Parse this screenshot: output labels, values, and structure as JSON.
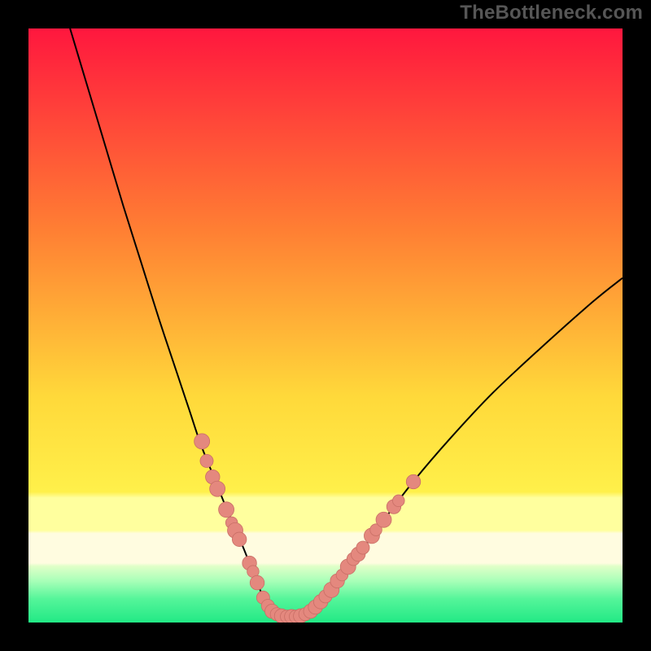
{
  "watermark": "TheBottleneck.com",
  "colors": {
    "frame": "#000000",
    "bg_top": "#ff173e",
    "bg_mid1": "#ff7f27",
    "bg_mid2": "#ffe635",
    "bg_band_light": "#ffff9e",
    "bg_band_cream": "#fffce0",
    "bg_bottom": "#27ec88",
    "curve": "#000000",
    "marker_fill": "#e4887e",
    "marker_stroke": "#c96f66"
  },
  "chart_data": {
    "type": "line",
    "title": "",
    "xlabel": "",
    "ylabel": "",
    "xlim": [
      0,
      100
    ],
    "ylim": [
      0,
      100
    ],
    "series": [
      {
        "name": "bottleneck-curve",
        "x": [
          7,
          10,
          13,
          16,
          19,
          22,
          25,
          27,
          29,
          31,
          33,
          34.5,
          36,
          37,
          38,
          38.8,
          39.4,
          40,
          40.5,
          41,
          42,
          43,
          44,
          45,
          46,
          47.5,
          49,
          51,
          53,
          56,
          60,
          65,
          71,
          78,
          86,
          95,
          100
        ],
        "y": [
          100,
          90,
          80,
          70,
          60.5,
          51,
          42,
          36,
          30,
          25,
          20,
          16.5,
          13,
          10.5,
          8,
          6,
          4.5,
          3.3,
          2.5,
          2,
          1.4,
          1.1,
          1,
          1,
          1.2,
          1.8,
          3,
          5.2,
          8,
          12,
          17.5,
          24,
          31,
          38.5,
          46,
          54,
          58
        ]
      }
    ],
    "markers": [
      {
        "x": 29.2,
        "y": 30.5,
        "r": 1.3
      },
      {
        "x": 30.0,
        "y": 27.2,
        "r": 1.1
      },
      {
        "x": 31.0,
        "y": 24.5,
        "r": 1.2
      },
      {
        "x": 31.8,
        "y": 22.5,
        "r": 1.3
      },
      {
        "x": 33.3,
        "y": 19.0,
        "r": 1.3
      },
      {
        "x": 34.2,
        "y": 16.8,
        "r": 1.0
      },
      {
        "x": 34.8,
        "y": 15.5,
        "r": 1.3
      },
      {
        "x": 35.5,
        "y": 14.0,
        "r": 1.2
      },
      {
        "x": 37.2,
        "y": 10.0,
        "r": 1.2
      },
      {
        "x": 37.8,
        "y": 8.6,
        "r": 1.0
      },
      {
        "x": 38.5,
        "y": 6.7,
        "r": 1.2
      },
      {
        "x": 39.5,
        "y": 4.2,
        "r": 1.1
      },
      {
        "x": 40.3,
        "y": 2.8,
        "r": 1.1
      },
      {
        "x": 41.0,
        "y": 1.9,
        "r": 1.2
      },
      {
        "x": 41.8,
        "y": 1.4,
        "r": 1.1
      },
      {
        "x": 42.6,
        "y": 1.1,
        "r": 1.2
      },
      {
        "x": 43.5,
        "y": 1.0,
        "r": 1.1
      },
      {
        "x": 44.3,
        "y": 1.0,
        "r": 1.2
      },
      {
        "x": 45.0,
        "y": 1.0,
        "r": 1.1
      },
      {
        "x": 45.8,
        "y": 1.1,
        "r": 1.2
      },
      {
        "x": 46.6,
        "y": 1.4,
        "r": 1.1
      },
      {
        "x": 47.5,
        "y": 1.9,
        "r": 1.2
      },
      {
        "x": 48.3,
        "y": 2.6,
        "r": 1.2
      },
      {
        "x": 49.2,
        "y": 3.5,
        "r": 1.2
      },
      {
        "x": 50.0,
        "y": 4.4,
        "r": 1.1
      },
      {
        "x": 51.0,
        "y": 5.5,
        "r": 1.3
      },
      {
        "x": 52.0,
        "y": 7.0,
        "r": 1.2
      },
      {
        "x": 52.8,
        "y": 8.0,
        "r": 1.0
      },
      {
        "x": 53.8,
        "y": 9.4,
        "r": 1.3
      },
      {
        "x": 54.7,
        "y": 10.7,
        "r": 1.1
      },
      {
        "x": 55.5,
        "y": 11.5,
        "r": 1.2
      },
      {
        "x": 56.3,
        "y": 12.6,
        "r": 1.1
      },
      {
        "x": 57.8,
        "y": 14.6,
        "r": 1.3
      },
      {
        "x": 58.5,
        "y": 15.6,
        "r": 1.0
      },
      {
        "x": 59.8,
        "y": 17.3,
        "r": 1.3
      },
      {
        "x": 61.5,
        "y": 19.5,
        "r": 1.2
      },
      {
        "x": 62.3,
        "y": 20.5,
        "r": 1.0
      },
      {
        "x": 64.8,
        "y": 23.7,
        "r": 1.2
      }
    ]
  }
}
